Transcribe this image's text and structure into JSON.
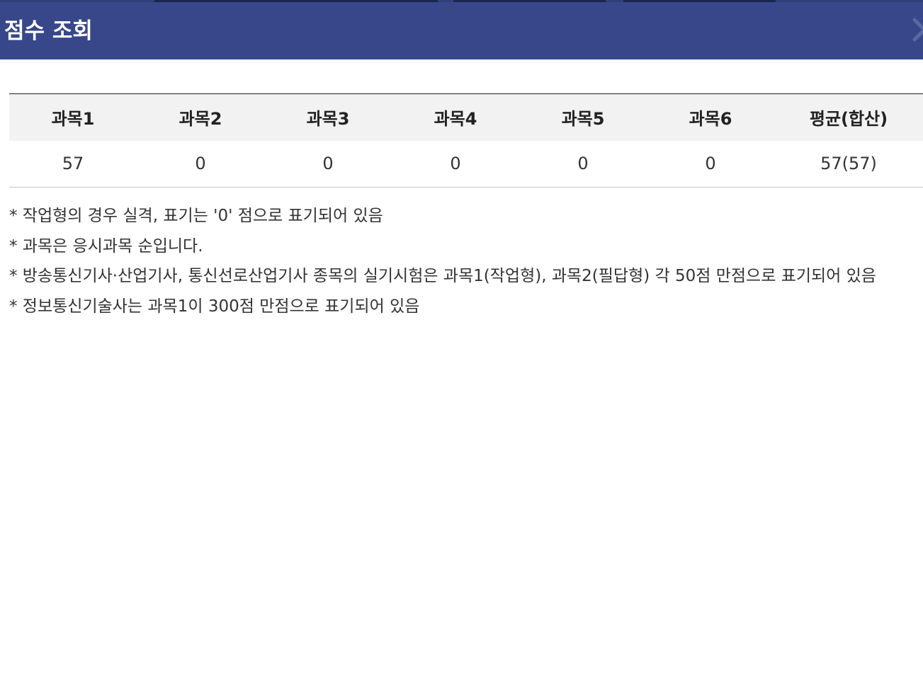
{
  "header": {
    "title": "점수 조회",
    "close_icon": "close-icon",
    "background_color": "#37478a"
  },
  "score_table": {
    "columns": [
      "과목1",
      "과목2",
      "과목3",
      "과목4",
      "과목5",
      "과목6",
      "평균(합산)"
    ],
    "rows": [
      [
        "57",
        "0",
        "0",
        "0",
        "0",
        "0",
        "57(57)"
      ]
    ]
  },
  "notes": [
    "* 작업형의 경우 실격, 표기는 '0' 점으로 표기되어 있음",
    "* 과목은 응시과목 순입니다.",
    "* 방송통신기사·산업기사, 통신선로산업기사 종목의 실기시험은 과목1(작업형), 과목2(필답형) 각 50점 만점으로 표기되어 있음",
    "* 정보통신기술사는 과목1이 300점 만점으로 표기되어 있음"
  ]
}
